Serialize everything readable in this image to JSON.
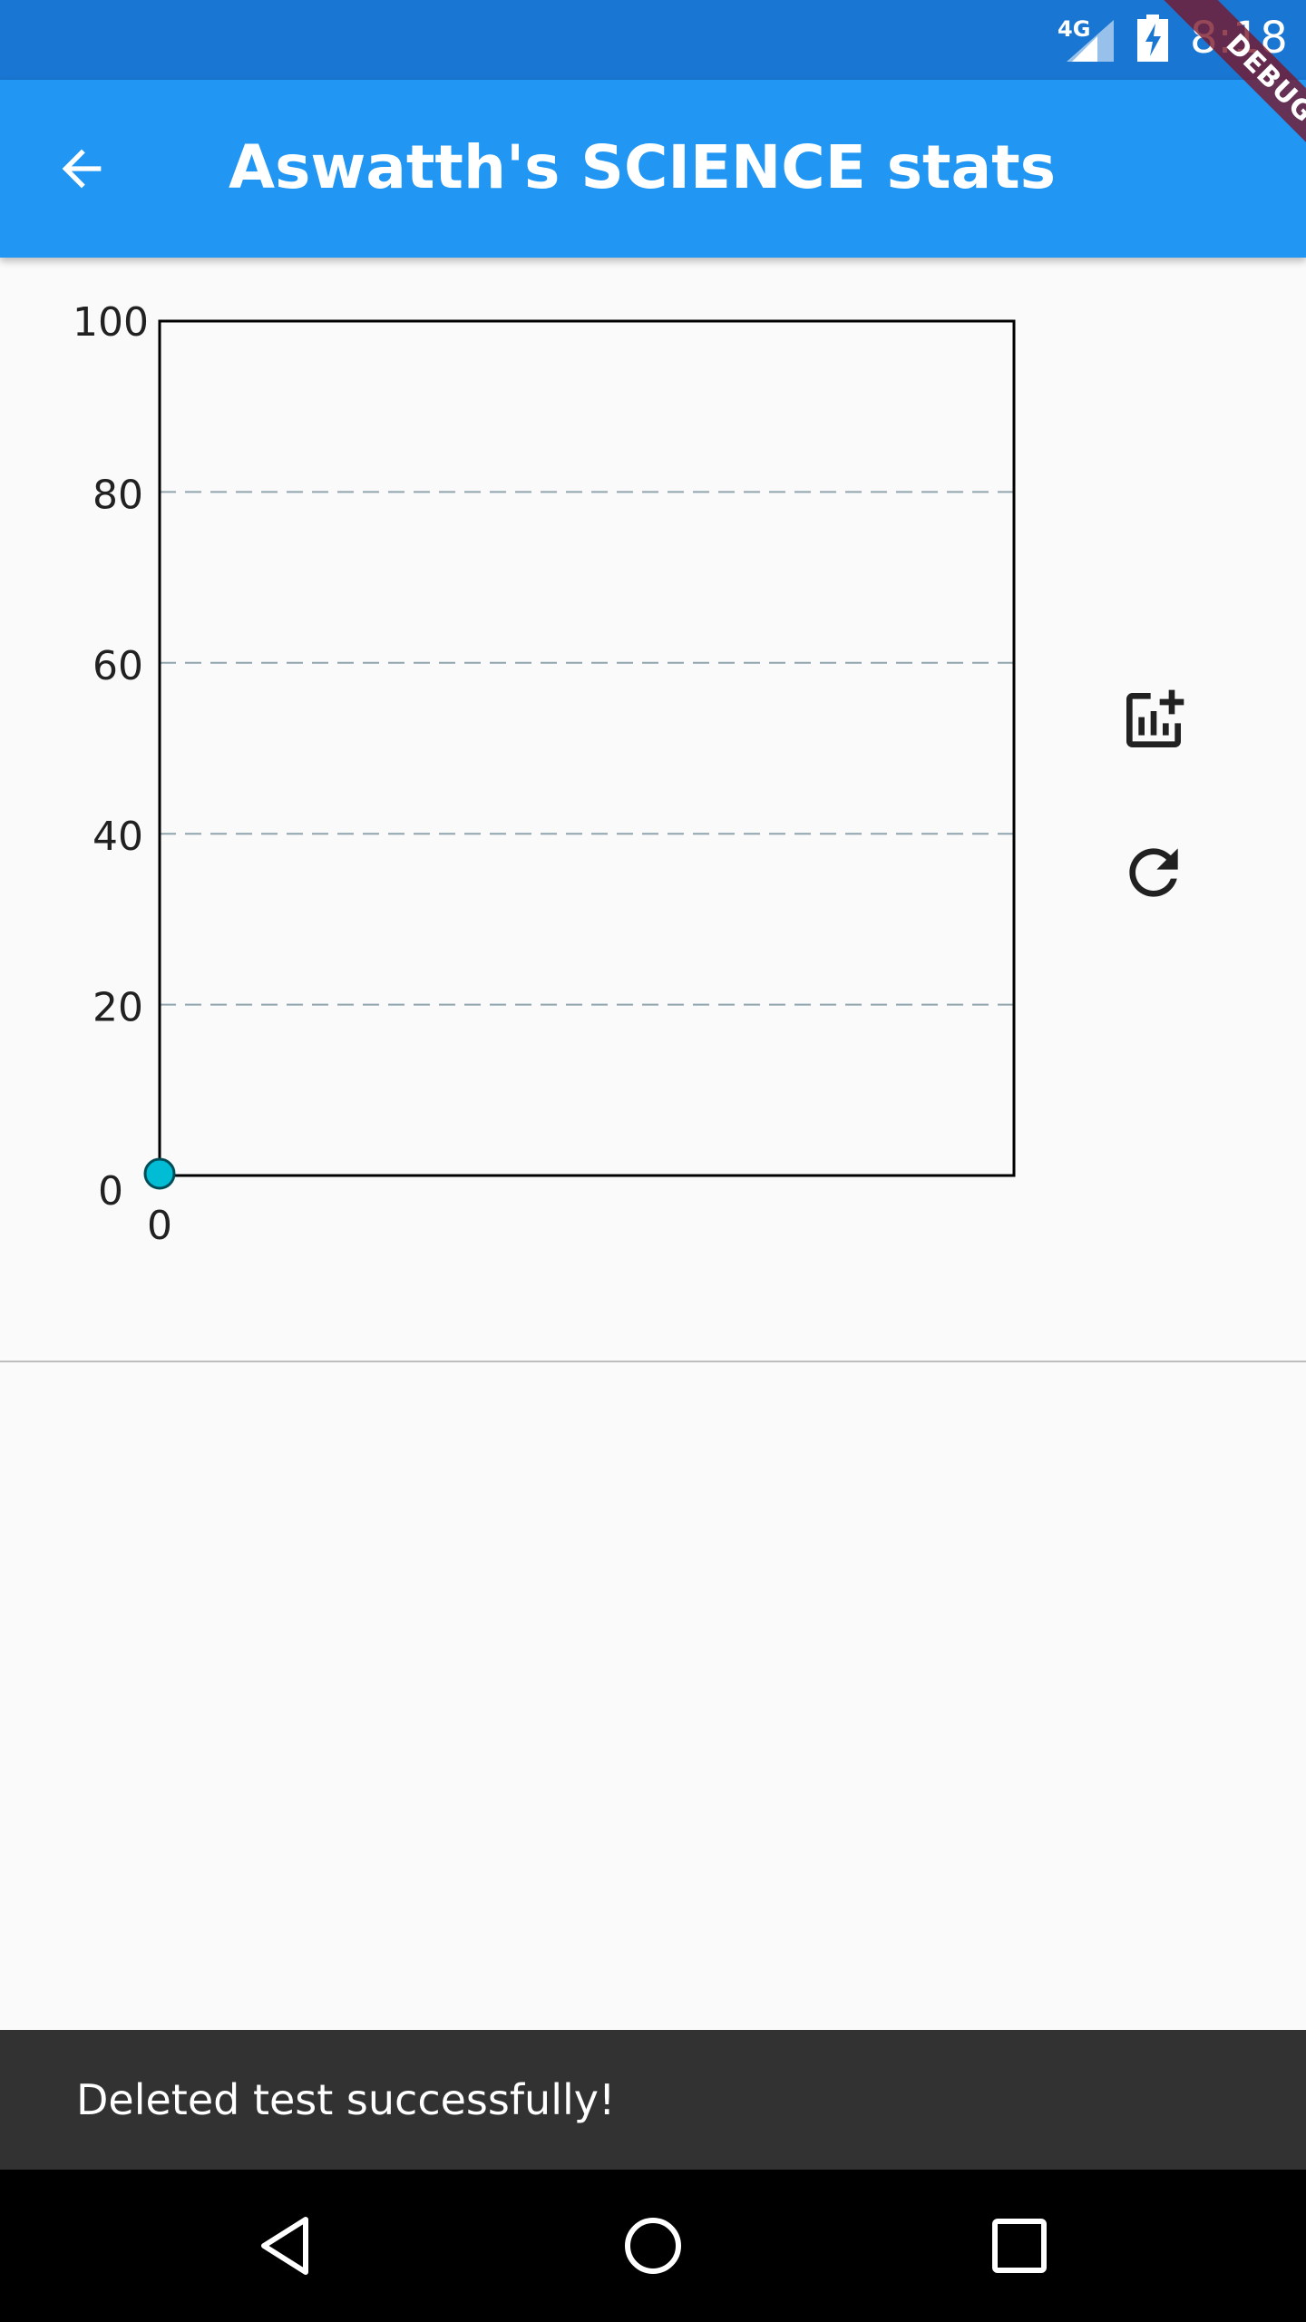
{
  "status_bar": {
    "network": "4G",
    "time": "8:18"
  },
  "debug_banner": "DEBUG",
  "app_bar": {
    "title": "Aswatth's SCIENCE stats",
    "back_icon": "arrow-back-icon"
  },
  "actions": {
    "add_chart_icon": "add-chart-icon",
    "refresh_icon": "refresh-icon"
  },
  "chart_data": {
    "type": "scatter",
    "ylim": [
      0,
      100
    ],
    "y_ticks": [
      "0",
      "20",
      "40",
      "60",
      "80",
      "100"
    ],
    "x_ticks": [
      "0"
    ],
    "grid": "dashed horizontal",
    "series": [
      {
        "x": [
          0
        ],
        "y": [
          0
        ],
        "color": "#00bcd4"
      }
    ]
  },
  "snackbar": {
    "message": "Deleted test successfully!"
  },
  "nav_bar": {
    "back_icon": "nav-back-icon",
    "home_icon": "nav-home-icon",
    "recents_icon": "nav-recents-icon"
  },
  "colors": {
    "status_bar": "#1976d2",
    "app_bar": "#2196f3",
    "point": "#00bcd4",
    "snackbar": "#323232"
  }
}
